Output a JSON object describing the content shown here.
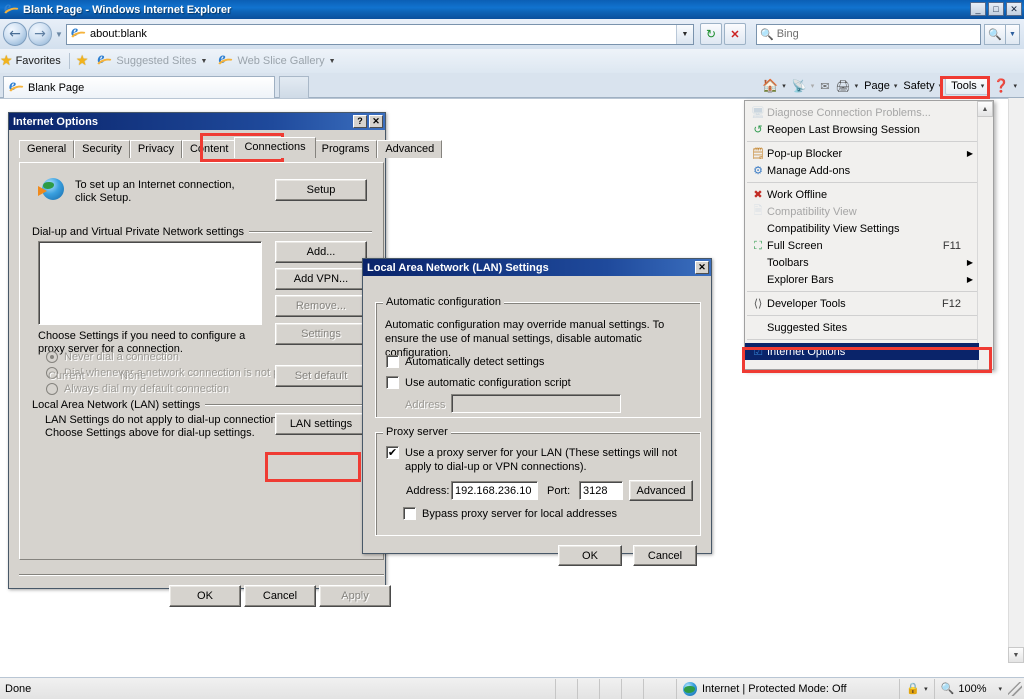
{
  "window": {
    "title": "Blank Page - Windows Internet Explorer",
    "minimize": "_",
    "maximize": "□",
    "close": "✕"
  },
  "nav": {
    "back": "←",
    "forward": "→",
    "history_caret": "▼",
    "url": "about:blank",
    "url_dropdown": "▼",
    "refresh": "↻",
    "stop": "✕",
    "search_placeholder": "Bing",
    "search_go": "search-icon",
    "search_dropdown": "▼"
  },
  "favorites_bar": {
    "favorites_label": "Favorites",
    "add_to_favorites": "add-favorites-icon",
    "suggested_sites": "Suggested Sites",
    "web_slice_gallery": "Web Slice Gallery"
  },
  "tabs": {
    "items": [
      {
        "label": "Blank Page"
      }
    ],
    "new_tab": ""
  },
  "command_bar": {
    "home": "home-icon",
    "feeds": "feeds-icon",
    "read_mail": "mail-icon",
    "print": "print-icon",
    "page": "Page",
    "safety": "Safety",
    "tools": "Tools",
    "help": "help-icon",
    "caret": "▾"
  },
  "tools_menu": {
    "scroll_up": "▲",
    "items": [
      {
        "label": "Diagnose Connection Problems...",
        "icon": "diagnose-icon",
        "disabled": true,
        "shortcut": "",
        "submenu": false,
        "separator_after": false
      },
      {
        "label": "Reopen Last Browsing Session",
        "icon": "reopen-session-icon",
        "disabled": false,
        "shortcut": "",
        "submenu": false,
        "separator_after": true
      },
      {
        "label": "Pop-up Blocker",
        "icon": "popup-blocker-icon",
        "disabled": false,
        "shortcut": "",
        "submenu": true,
        "separator_after": false
      },
      {
        "label": "Manage Add-ons",
        "icon": "manage-addons-icon",
        "disabled": false,
        "shortcut": "",
        "submenu": false,
        "separator_after": true
      },
      {
        "label": "Work Offline",
        "icon": "work-offline-icon",
        "disabled": false,
        "shortcut": "",
        "submenu": false,
        "separator_after": false
      },
      {
        "label": "Compatibility View",
        "icon": "compatibility-view-icon",
        "disabled": true,
        "shortcut": "",
        "submenu": false,
        "separator_after": false
      },
      {
        "label": "Compatibility View Settings",
        "icon": "",
        "disabled": false,
        "shortcut": "",
        "submenu": false,
        "separator_after": false
      },
      {
        "label": "Full Screen",
        "icon": "full-screen-icon",
        "disabled": false,
        "shortcut": "F11",
        "submenu": false,
        "separator_after": false
      },
      {
        "label": "Toolbars",
        "icon": "",
        "disabled": false,
        "shortcut": "",
        "submenu": true,
        "separator_after": false
      },
      {
        "label": "Explorer Bars",
        "icon": "",
        "disabled": false,
        "shortcut": "",
        "submenu": true,
        "separator_after": true
      },
      {
        "label": "Developer Tools",
        "icon": "developer-tools-icon",
        "disabled": false,
        "shortcut": "F12",
        "submenu": false,
        "separator_after": true
      },
      {
        "label": "Suggested Sites",
        "icon": "",
        "disabled": false,
        "shortcut": "",
        "submenu": false,
        "separator_after": true
      },
      {
        "label": "Internet Options",
        "icon": "internet-options-icon",
        "disabled": false,
        "shortcut": "",
        "submenu": false,
        "separator_after": false,
        "selected": true
      }
    ]
  },
  "internet_options": {
    "title": "Internet Options",
    "help_btn": "?",
    "close_btn": "✕",
    "tabs": [
      {
        "label": "General",
        "active": false
      },
      {
        "label": "Security",
        "active": false
      },
      {
        "label": "Privacy",
        "active": false
      },
      {
        "label": "Content",
        "active": false
      },
      {
        "label": "Connections",
        "active": true
      },
      {
        "label": "Programs",
        "active": false
      },
      {
        "label": "Advanced",
        "active": false
      }
    ],
    "setup_text": "To set up an Internet connection, click Setup.",
    "setup_button": "Setup",
    "dialup_group": "Dial-up and Virtual Private Network settings",
    "list_items": [],
    "add_button": "Add...",
    "add_vpn_button": "Add VPN...",
    "remove_button": "Remove...",
    "settings_button": "Settings",
    "choose_settings_text": "Choose Settings if you need to configure a proxy server for a connection.",
    "radios": [
      {
        "label": "Never dial a connection",
        "selected": true
      },
      {
        "label": "Dial whenever a network connection is not present",
        "selected": false
      },
      {
        "label": "Always dial my default connection",
        "selected": false
      }
    ],
    "current_label": "Current",
    "current_value": "None",
    "set_default_button": "Set default",
    "lan_group": "Local Area Network (LAN) settings",
    "lan_text_line1": "LAN Settings do not apply to dial-up connections.",
    "lan_text_line2": "Choose Settings above for dial-up settings.",
    "lan_settings_button": "LAN settings",
    "ok_button": "OK",
    "cancel_button": "Cancel",
    "apply_button": "Apply"
  },
  "lan_settings": {
    "title": "Local Area Network (LAN) Settings",
    "close_btn": "✕",
    "auto_group": "Automatic configuration",
    "auto_desc": "Automatic configuration may override manual settings.  To ensure the use of manual settings, disable automatic configuration.",
    "auto_detect_label": "Automatically detect settings",
    "auto_detect_checked": false,
    "auto_script_label": "Use automatic configuration script",
    "auto_script_checked": false,
    "address_label": "Address",
    "address_value": "",
    "proxy_group": "Proxy server",
    "use_proxy_label": "Use a proxy server for your LAN (These settings will not apply to dial-up or VPN connections).",
    "use_proxy_checked": true,
    "proxy_address_label": "Address:",
    "proxy_address_value": "192.168.236.10",
    "proxy_port_label": "Port:",
    "proxy_port_value": "3128",
    "advanced_button": "Advanced",
    "bypass_label": "Bypass proxy server for local addresses",
    "bypass_checked": false,
    "ok_button": "OK",
    "cancel_button": "Cancel"
  },
  "status_bar": {
    "message": "Done",
    "zone": "Internet | Protected Mode: Off",
    "zone_icon": "globe-icon",
    "protected_icon": "shield-icon",
    "zoom_icon": "zoom-icon",
    "zoom_level": "100%",
    "caret": "▾"
  },
  "colors": {
    "annotation_red": "#ef3b33",
    "menu_selection_blue": "#0a246a",
    "dialog_face": "#d6d3ce",
    "title_blue": "#0a246a"
  }
}
